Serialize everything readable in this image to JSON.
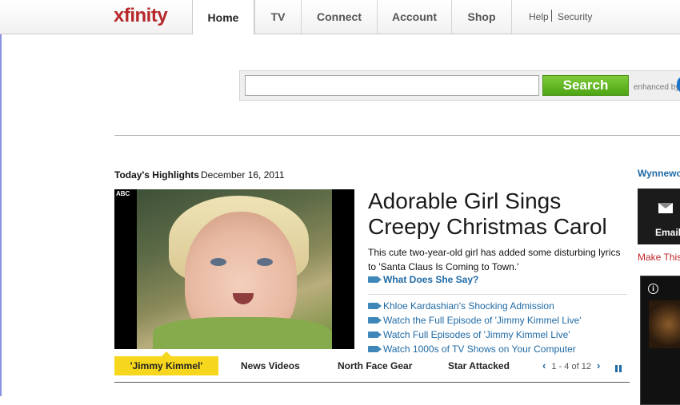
{
  "brand": {
    "logo": "xfinity"
  },
  "nav": {
    "tabs": [
      {
        "label": "Home"
      },
      {
        "label": "TV"
      },
      {
        "label": "Connect"
      },
      {
        "label": "Account"
      },
      {
        "label": "Shop"
      }
    ],
    "utility": {
      "help": "Help",
      "security": "Security"
    }
  },
  "search": {
    "query": "",
    "button_label": "Search",
    "enhanced_label": "enhanced by"
  },
  "highlights": {
    "title": "Today's Highlights",
    "date": "December 16, 2011",
    "video_badge": "ABC",
    "headline": "Adorable Girl Sings Creepy Christmas Carol",
    "teaser": "This cute two-year-old girl has added some disturbing lyrics to 'Santa Claus Is Coming to Town.'",
    "main_link": "What Does She Say?",
    "related_links": [
      "Khloe Kardashian's Shocking Admission",
      "Watch the Full Episode of 'Jimmy Kimmel Live'",
      "Watch Full Episodes of 'Jimmy Kimmel Live'",
      "Watch 1000s of TV Shows on Your Computer"
    ],
    "bottom_tabs": [
      "'Jimmy Kimmel'",
      "News Videos",
      "North Face Gear",
      "Star Attacked"
    ],
    "pager": {
      "prev": "‹",
      "text": "1 - 4 of 12",
      "next": "›"
    }
  },
  "right_column": {
    "location_link": "Wynnewo",
    "email_label": "Email",
    "make_this": "Make This",
    "info_glyph": "i"
  },
  "colors": {
    "logo": "#b6282a",
    "search_button": "#5cb320",
    "link": "#1f6aa5",
    "active_bottom_tab": "#f7d71d"
  }
}
